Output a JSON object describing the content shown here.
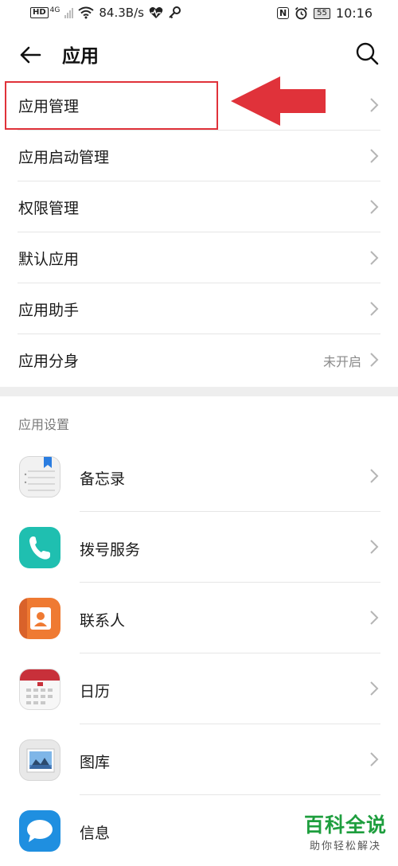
{
  "status_bar": {
    "network_badge": "HD",
    "network_type": "4G",
    "speed": "84.3B/s",
    "nfc": "N",
    "battery": "55",
    "time": "10:16"
  },
  "header": {
    "title": "应用"
  },
  "menu": [
    {
      "label": "应用管理",
      "value": ""
    },
    {
      "label": "应用启动管理",
      "value": ""
    },
    {
      "label": "权限管理",
      "value": ""
    },
    {
      "label": "默认应用",
      "value": ""
    },
    {
      "label": "应用助手",
      "value": ""
    },
    {
      "label": "应用分身",
      "value": "未开启"
    }
  ],
  "section_title": "应用设置",
  "apps": [
    {
      "label": "备忘录",
      "icon": "notepad-icon"
    },
    {
      "label": "拨号服务",
      "icon": "phone-icon"
    },
    {
      "label": "联系人",
      "icon": "contacts-icon"
    },
    {
      "label": "日历",
      "icon": "calendar-icon"
    },
    {
      "label": "图库",
      "icon": "gallery-icon"
    },
    {
      "label": "信息",
      "icon": "message-icon"
    }
  ],
  "watermark": {
    "main": "百科全说",
    "sub": "助你轻松解决"
  },
  "colors": {
    "annotation_red": "#e0323a",
    "watermark_green": "#1e9e3e",
    "phone_teal": "#1fbfb0",
    "contacts_orange": "#ef7a32",
    "message_blue": "#1f8fe0"
  }
}
